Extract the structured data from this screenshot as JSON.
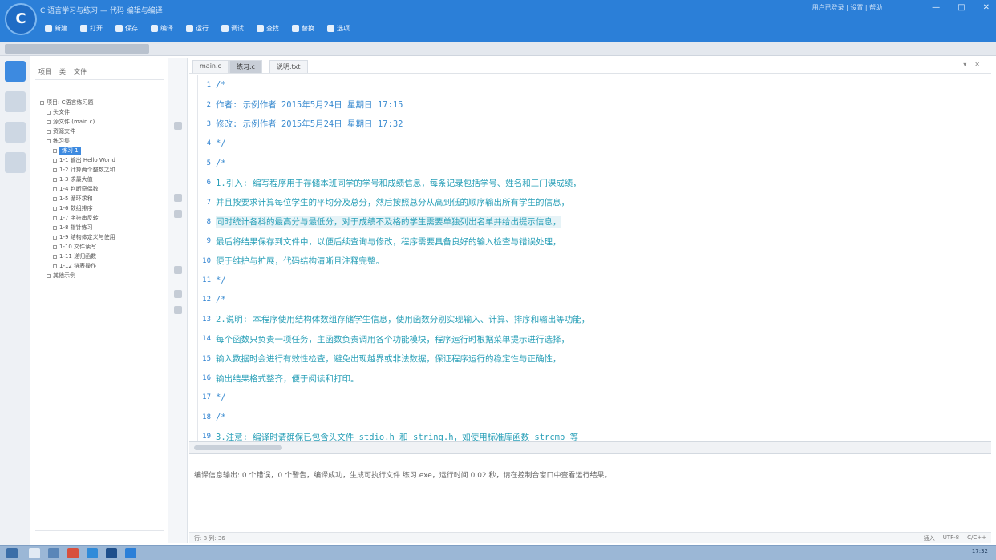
{
  "window": {
    "logo": "C",
    "title": "C 语言学习与练习 — 代码 编辑与编译",
    "user_info": "用户已登录 | 设置 | 帮助",
    "controls": [
      "—",
      "□",
      "✕"
    ]
  },
  "toolbar": [
    {
      "label": "新建",
      "icon": "new-file-icon"
    },
    {
      "label": "打开",
      "icon": "folder-icon"
    },
    {
      "label": "保存",
      "icon": "save-icon"
    },
    {
      "label": "编译",
      "icon": "build-icon"
    },
    {
      "label": "运行",
      "icon": "run-icon"
    },
    {
      "label": "调试",
      "icon": "debug-icon"
    },
    {
      "label": "查找",
      "icon": "search-icon"
    },
    {
      "label": "替换",
      "icon": "replace-icon"
    },
    {
      "label": "选项",
      "icon": "options-icon"
    }
  ],
  "sidebar": {
    "header_tabs": [
      "项目",
      "类",
      "文件"
    ],
    "tree": [
      {
        "label": "项目: C语言练习题",
        "depth": 0
      },
      {
        "label": "头文件",
        "depth": 1
      },
      {
        "label": "源文件 (main.c)",
        "depth": 1
      },
      {
        "label": "资源文件",
        "depth": 1
      },
      {
        "label": "练习集",
        "depth": 1
      },
      {
        "label": "练习 1",
        "depth": 2,
        "selected": true
      },
      {
        "label": "1-1 输出 Hello World",
        "depth": 2
      },
      {
        "label": "1-2 计算两个整数之和",
        "depth": 2
      },
      {
        "label": "1-3 求最大值",
        "depth": 2
      },
      {
        "label": "1-4 判断奇偶数",
        "depth": 2
      },
      {
        "label": "1-5 循环求和",
        "depth": 2
      },
      {
        "label": "1-6 数组排序",
        "depth": 2
      },
      {
        "label": "1-7 字符串反转",
        "depth": 2
      },
      {
        "label": "1-8 指针练习",
        "depth": 2
      },
      {
        "label": "1-9 结构体定义与使用",
        "depth": 2
      },
      {
        "label": "1-10 文件读写",
        "depth": 2
      },
      {
        "label": "1-11 递归函数",
        "depth": 2
      },
      {
        "label": "1-12 链表操作",
        "depth": 2
      },
      {
        "label": "其他示例",
        "depth": 1
      }
    ]
  },
  "editor": {
    "tabs": [
      "main.c",
      "练习.c",
      "说明.txt"
    ],
    "active_tab": 1,
    "lines": [
      {
        "n": "1",
        "text": "/*",
        "comment": true
      },
      {
        "n": "2",
        "text": "  作者: 示例作者 2015年5月24日 星期日 17:15",
        "comment": true
      },
      {
        "n": "3",
        "text": "  修改: 示例作者 2015年5月24日 星期日 17:32",
        "comment": true
      },
      {
        "n": "4",
        "text": "*/",
        "comment": true
      },
      {
        "n": "5",
        "text": "/*",
        "comment": true
      },
      {
        "n": "6",
        "text": "  1.引入: 编写程序用于存储本班同学的学号和成绩信息，每条记录包括学号、姓名和三门课成绩，",
        "comment": false
      },
      {
        "n": "7",
        "text": "  并且按要求计算每位学生的平均分及总分，然后按照总分从高到低的顺序输出所有学生的信息，",
        "comment": false
      },
      {
        "n": "8",
        "text": "  同时统计各科的最高分与最低分，对于成绩不及格的学生需要单独列出名单并给出提示信息，",
        "comment": false,
        "highlight": true
      },
      {
        "n": "9",
        "text": "  最后将结果保存到文件中，以便后续查询与修改，程序需要具备良好的输入检查与错误处理，",
        "comment": false
      },
      {
        "n": "10",
        "text": "  便于维护与扩展，代码结构清晰且注释完整。",
        "comment": false
      },
      {
        "n": "11",
        "text": "*/",
        "comment": true
      },
      {
        "n": "12",
        "text": "/*",
        "comment": true
      },
      {
        "n": "13",
        "text": "  2.说明: 本程序使用结构体数组存储学生信息，使用函数分别实现输入、计算、排序和输出等功能，",
        "comment": false
      },
      {
        "n": "14",
        "text": "  每个函数只负责一项任务，主函数负责调用各个功能模块，程序运行时根据菜单提示进行选择，",
        "comment": false
      },
      {
        "n": "15",
        "text": "  输入数据时会进行有效性检查，避免出现越界或非法数据，保证程序运行的稳定性与正确性，",
        "comment": false
      },
      {
        "n": "16",
        "text": "  输出结果格式整齐，便于阅读和打印。",
        "comment": false
      },
      {
        "n": "17",
        "text": "*/",
        "comment": true
      },
      {
        "n": "18",
        "text": "/*",
        "comment": true
      },
      {
        "n": "19",
        "text": "  3.注意: 编译时请确保已包含头文件 stdio.h 和 string.h，如使用标准库函数 strcmp 等",
        "comment": false
      }
    ]
  },
  "output": {
    "message": "编译信息输出: 0 个错误，0 个警告，编译成功，生成可执行文件 练习.exe，运行时间 0.02 秒，请在控制台窗口中查看运行结果。"
  },
  "status": {
    "left": "行: 8 列: 36",
    "right": [
      "插入",
      "UTF-8",
      "C/C++"
    ]
  },
  "taskbar": {
    "tray_time": "17:32"
  }
}
